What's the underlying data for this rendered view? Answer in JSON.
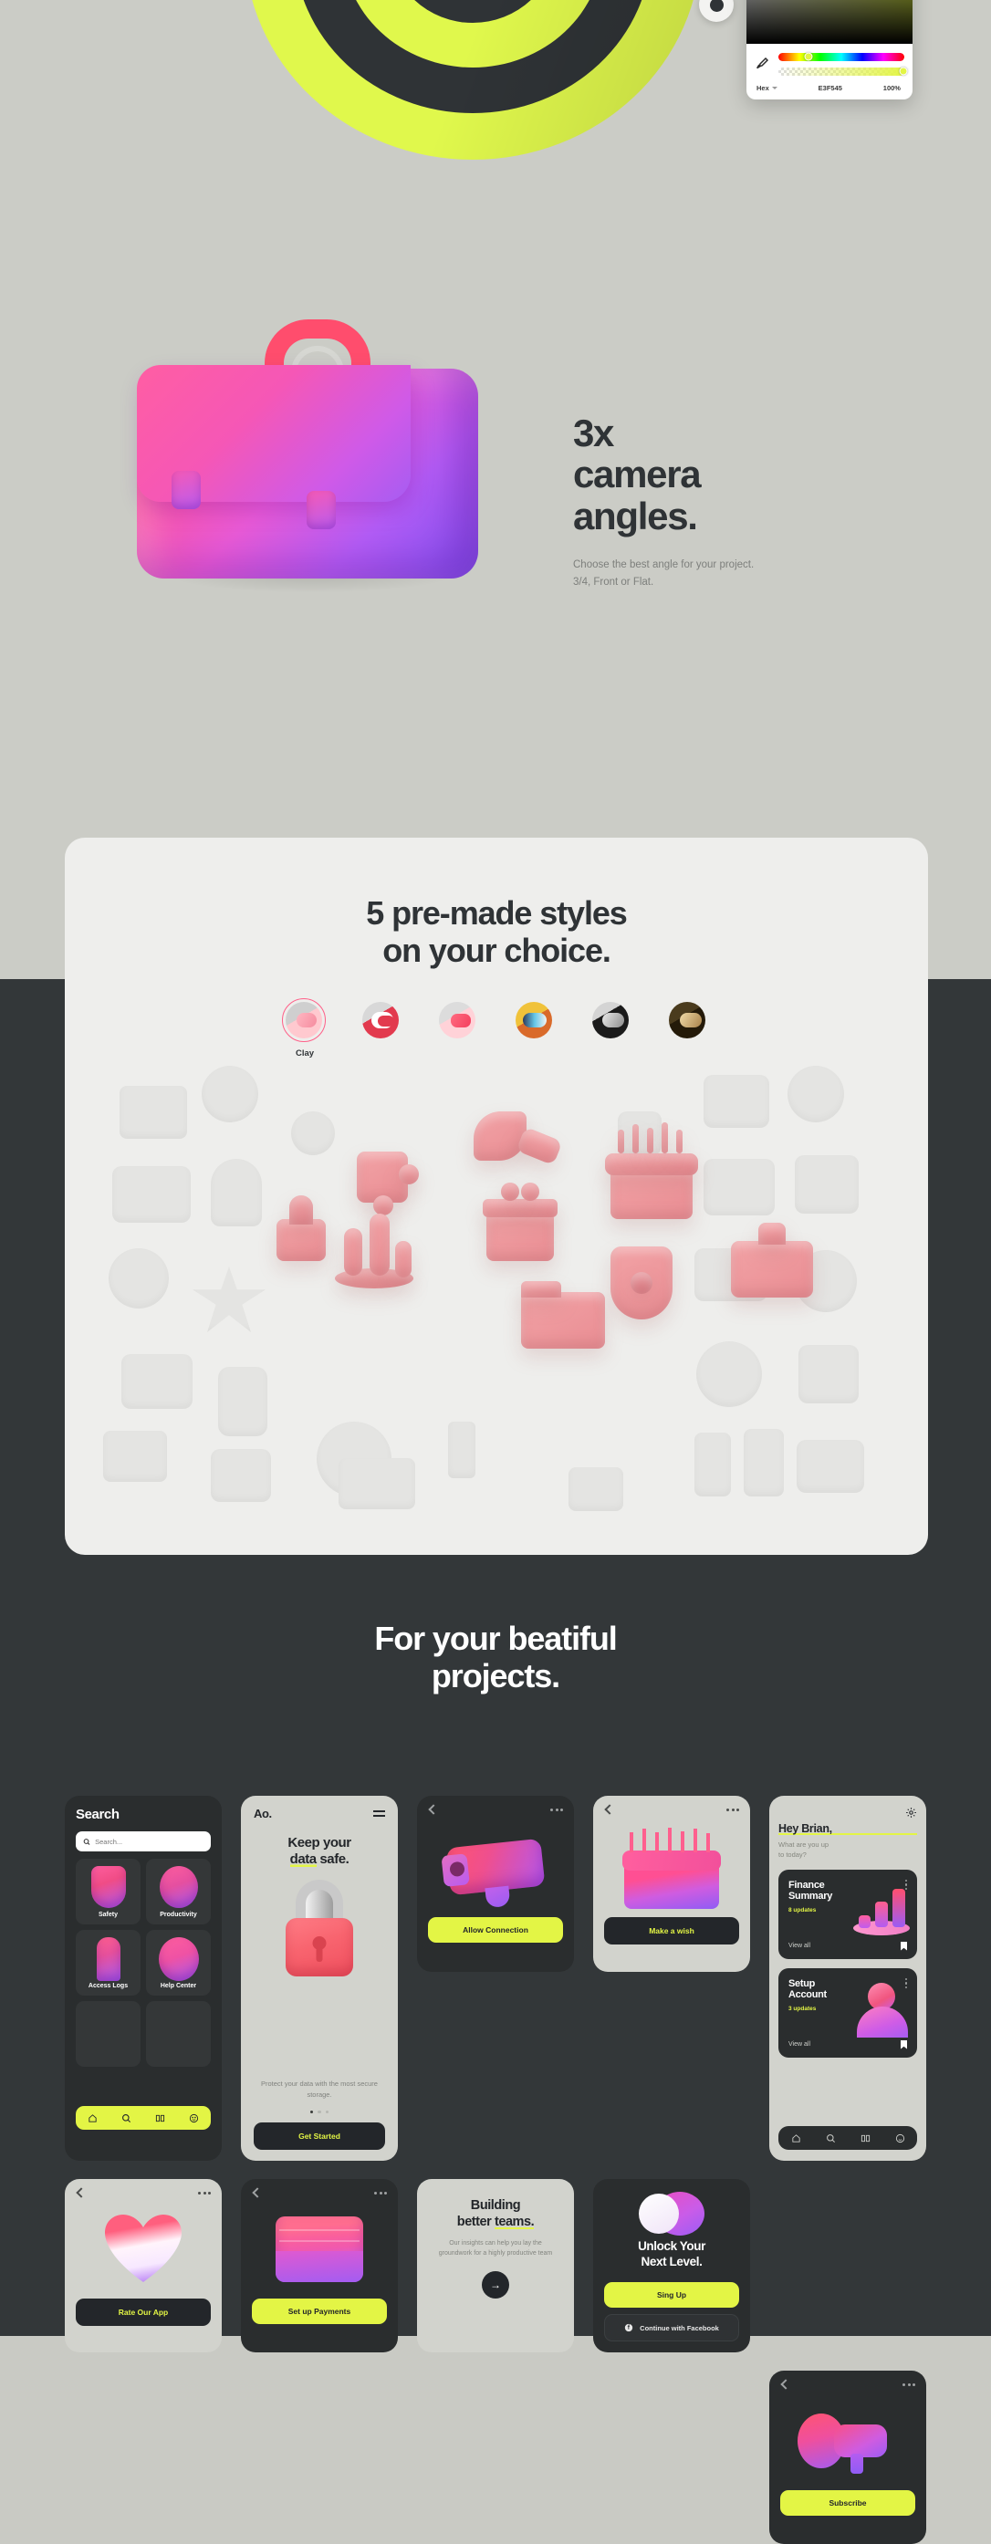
{
  "hero": {
    "heading_lines": [
      "3x",
      "camera",
      "angles."
    ],
    "subtitle_lines": [
      "Choose the best angle for your project.",
      "3/4, Front or Flat."
    ],
    "picker": {
      "hex_label": "Hex",
      "hex_value": "E3F545",
      "opacity": "100%",
      "accent": "#E3F545",
      "eyedropper_icon": "eyedropper-icon"
    },
    "target_colors": {
      "yellow": "#E0F84C",
      "dark": "#2F3336"
    },
    "briefcase_icon": "briefcase-3d-icon"
  },
  "styles_section": {
    "heading_lines": [
      "5 pre-made styles",
      "on your choice."
    ],
    "swatches": [
      {
        "name": "Clay",
        "label": "Clay",
        "selected": true
      },
      {
        "name": "Red Clay",
        "label": "",
        "selected": false
      },
      {
        "name": "Soft Pink",
        "label": "",
        "selected": false
      },
      {
        "name": "Color",
        "label": "",
        "selected": false
      },
      {
        "name": "Mono",
        "label": "",
        "selected": false
      },
      {
        "name": "Gold",
        "label": "",
        "selected": false
      }
    ]
  },
  "projects_section": {
    "heading_lines": [
      "For your beatiful",
      "projects."
    ]
  },
  "mocks": {
    "search": {
      "title": "Search",
      "search_placeholder": "Search...",
      "search_value": "",
      "search_icon": "search-icon",
      "tiles": [
        {
          "label": "Safety",
          "icon": "shield-3d-icon"
        },
        {
          "label": "Productivity",
          "icon": "stopwatch-3d-icon"
        },
        {
          "label": "Access Logs",
          "icon": "key-3d-icon"
        },
        {
          "label": "Help Center",
          "icon": "lifebuoy-3d-icon"
        }
      ],
      "nav": [
        "home-icon",
        "search-icon",
        "book-icon",
        "smiley-icon"
      ]
    },
    "ao": {
      "logo": "Ao.",
      "menu_icon": "hamburger-icon",
      "heading_plain_1": "Keep your",
      "heading_highlight": "data",
      "heading_plain_2": " safe.",
      "subtitle": "Protect your data with the most secure storage.",
      "cta": "Get Started",
      "lock_icon": "padlock-3d-icon",
      "pager_active": 0,
      "pager_count": 3
    },
    "camera": {
      "back_icon": "chevron-left-icon",
      "more_icon": "more-horizontal-icon",
      "art_icon": "security-camera-3d-icon",
      "cta": "Allow Connection"
    },
    "cake": {
      "back_icon": "chevron-left-icon",
      "more_icon": "more-horizontal-icon",
      "art_icon": "birthday-cake-3d-icon",
      "cta": "Make a wish"
    },
    "dashboard": {
      "settings_icon": "gear-icon",
      "greeting": "Hey Brian,",
      "question_lines": [
        "What are you up",
        "to today?"
      ],
      "cards": [
        {
          "title_lines": [
            "Finance",
            "Summary"
          ],
          "updates": "8 updates",
          "view_all": "View all",
          "art_icon": "bar-chart-3d-icon",
          "bookmark_icon": "bookmark-icon"
        },
        {
          "title_lines": [
            "Setup",
            "Account"
          ],
          "updates": "3 updates",
          "view_all": "View all",
          "art_icon": "avatar-3d-icon",
          "bookmark_icon": "bookmark-icon"
        }
      ],
      "nav": [
        "home-icon",
        "search-icon",
        "book-icon",
        "smiley-icon"
      ]
    },
    "teams": {
      "heading_plain_1": "Building",
      "heading_plain_2": "better ",
      "heading_highlight": "teams.",
      "subtitle": "Our insights can help you lay the groundwork for a highly productive team",
      "arrow_icon": "arrow-right-icon",
      "art_icon": "flag-3d-icon"
    },
    "unlock": {
      "heading_lines": [
        "Unlock Your",
        "Next Level."
      ],
      "art_icon": "coins-3d-icon",
      "primary_cta": "Sing Up",
      "facebook_cta": "Continue with Facebook",
      "facebook_icon": "facebook-icon"
    },
    "heart": {
      "back_icon": "chevron-left-icon",
      "more_icon": "more-horizontal-icon",
      "art_icon": "heart-3d-icon",
      "cta": "Rate Our App"
    },
    "wallet": {
      "back_icon": "chevron-left-icon",
      "more_icon": "more-horizontal-icon",
      "art_icon": "wallet-3d-icon",
      "cta": "Set up Payments"
    },
    "megaphone": {
      "back_icon": "chevron-left-icon",
      "more_icon": "more-horizontal-icon",
      "art_icon": "megaphone-3d-icon",
      "cta": "Subscribe"
    }
  }
}
